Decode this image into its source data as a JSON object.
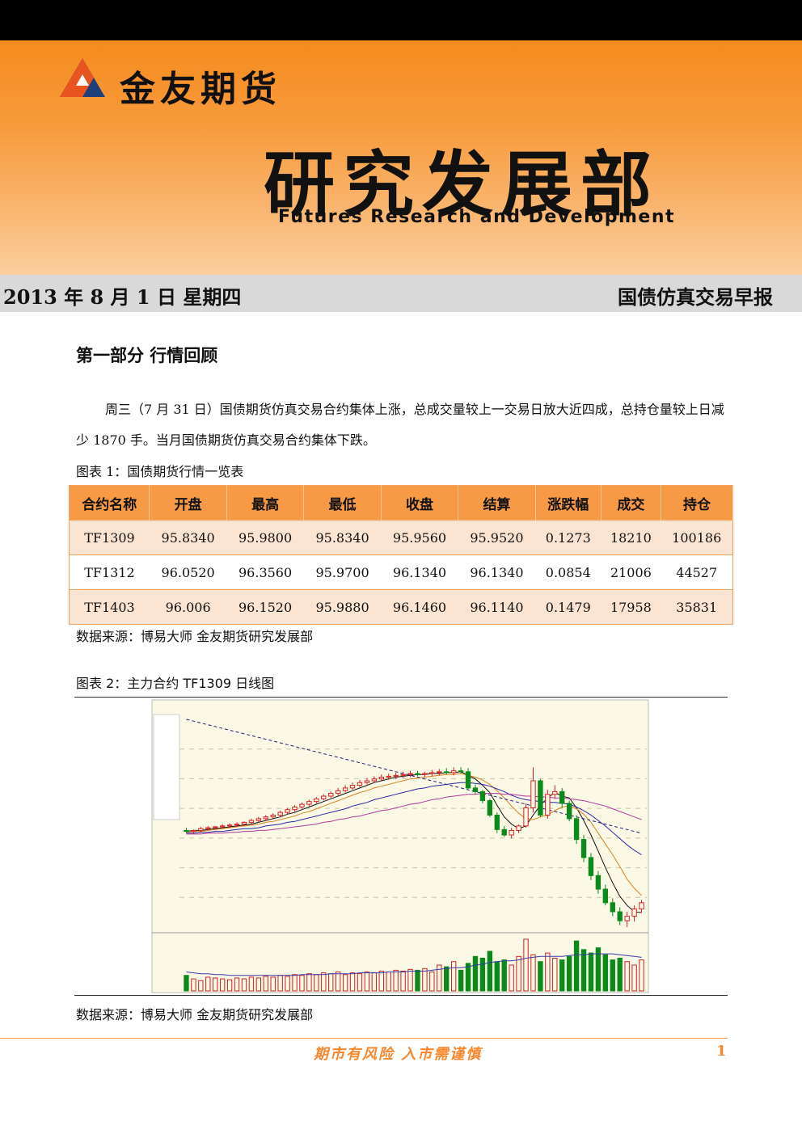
{
  "header": {
    "company": "金友期货",
    "department": "研究发展部",
    "department_en": "Futures Research and Development",
    "date": "2013 年 8 月 1 日 星期四",
    "report_title": "国债仿真交易早报"
  },
  "section": {
    "title": "第一部分 行情回顾",
    "paragraph": "周三（7 月 31 日）国债期货仿真交易合约集体上涨，总成交量较上一交易日放大近四成，总持仓量较上日减少 1870 手。当月国债期货仿真交易合约集体下跌。"
  },
  "table": {
    "caption": "图表 1：国债期货行情一览表",
    "headers": [
      "合约名称",
      "开盘",
      "最高",
      "最低",
      "收盘",
      "结算",
      "涨跌幅",
      "成交",
      "持仓"
    ],
    "rows": [
      [
        "TF1309",
        "95.8340",
        "95.9800",
        "95.8340",
        "95.9560",
        "95.9520",
        "0.1273",
        "18210",
        "100186"
      ],
      [
        "TF1312",
        "96.0520",
        "96.3560",
        "95.9700",
        "96.1340",
        "96.1340",
        "0.0854",
        "21006",
        "44527"
      ],
      [
        "TF1403",
        "96.006",
        "96.1520",
        "95.9880",
        "96.1460",
        "96.1140",
        "0.1479",
        "17958",
        "35831"
      ]
    ],
    "source": "数据来源：博易大师 金友期货研究发展部"
  },
  "chart_section": {
    "caption": "图表 2：主力合约 TF1309 日线图",
    "source": "数据来源：博易大师 金友期货研究发展部"
  },
  "chart_data": {
    "type": "candlestick",
    "title": "",
    "candles": [
      [
        94.75,
        94.78,
        94.72,
        94.74
      ],
      [
        94.74,
        94.76,
        94.71,
        94.75
      ],
      [
        94.75,
        94.79,
        94.73,
        94.77
      ],
      [
        94.77,
        94.8,
        94.75,
        94.78
      ],
      [
        94.78,
        94.8,
        94.76,
        94.79
      ],
      [
        94.79,
        94.82,
        94.77,
        94.8
      ],
      [
        94.8,
        94.83,
        94.78,
        94.81
      ],
      [
        94.81,
        94.84,
        94.79,
        94.82
      ],
      [
        94.82,
        94.85,
        94.8,
        94.84
      ],
      [
        94.84,
        94.88,
        94.82,
        94.86
      ],
      [
        94.86,
        94.9,
        94.84,
        94.88
      ],
      [
        94.88,
        94.92,
        94.86,
        94.9
      ],
      [
        94.9,
        94.94,
        94.88,
        94.92
      ],
      [
        94.92,
        94.97,
        94.9,
        94.95
      ],
      [
        94.95,
        95.0,
        94.93,
        94.98
      ],
      [
        94.98,
        95.03,
        94.96,
        95.01
      ],
      [
        95.01,
        95.06,
        94.99,
        95.04
      ],
      [
        95.04,
        95.09,
        95.02,
        95.07
      ],
      [
        95.07,
        95.12,
        95.05,
        95.1
      ],
      [
        95.1,
        95.15,
        95.08,
        95.13
      ],
      [
        95.13,
        95.18,
        95.11,
        95.16
      ],
      [
        95.16,
        95.22,
        95.14,
        95.19
      ],
      [
        95.19,
        95.25,
        95.17,
        95.22
      ],
      [
        95.22,
        95.28,
        95.2,
        95.25
      ],
      [
        95.25,
        95.31,
        95.23,
        95.28
      ],
      [
        95.28,
        95.33,
        95.26,
        95.3
      ],
      [
        95.3,
        95.35,
        95.28,
        95.32
      ],
      [
        95.32,
        95.37,
        95.3,
        95.34
      ],
      [
        95.34,
        95.38,
        95.31,
        95.35
      ],
      [
        95.35,
        95.39,
        95.32,
        95.36
      ],
      [
        95.36,
        95.4,
        95.33,
        95.37
      ],
      [
        95.37,
        95.41,
        95.34,
        95.38
      ],
      [
        95.38,
        95.41,
        95.35,
        95.37
      ],
      [
        95.37,
        95.4,
        95.34,
        95.38
      ],
      [
        95.38,
        95.42,
        95.35,
        95.39
      ],
      [
        95.39,
        95.43,
        95.36,
        95.4
      ],
      [
        95.4,
        95.44,
        95.37,
        95.39
      ],
      [
        95.39,
        95.45,
        95.36,
        95.41
      ],
      [
        95.41,
        95.45,
        95.38,
        95.4
      ],
      [
        95.4,
        95.44,
        95.2,
        95.22
      ],
      [
        95.22,
        95.26,
        95.15,
        95.18
      ],
      [
        95.18,
        95.2,
        95.05,
        95.08
      ],
      [
        95.08,
        95.1,
        94.9,
        94.92
      ],
      [
        94.92,
        94.95,
        94.72,
        94.76
      ],
      [
        94.76,
        94.8,
        94.68,
        94.7
      ],
      [
        94.7,
        94.78,
        94.66,
        94.75
      ],
      [
        94.75,
        94.82,
        94.72,
        94.8
      ],
      [
        94.8,
        95.05,
        94.78,
        95.0
      ],
      [
        95.0,
        95.45,
        94.95,
        95.3
      ],
      [
        95.3,
        95.32,
        94.9,
        94.92
      ],
      [
        94.92,
        95.2,
        94.88,
        95.15
      ],
      [
        95.15,
        95.25,
        95.1,
        95.18
      ],
      [
        95.18,
        95.22,
        95.0,
        95.05
      ],
      [
        95.05,
        95.08,
        94.85,
        94.88
      ],
      [
        94.88,
        94.92,
        94.6,
        94.65
      ],
      [
        94.65,
        94.7,
        94.4,
        94.45
      ],
      [
        94.45,
        94.5,
        94.2,
        94.25
      ],
      [
        94.25,
        94.3,
        94.05,
        94.1
      ],
      [
        94.1,
        94.15,
        93.92,
        93.95
      ],
      [
        93.95,
        94.0,
        93.8,
        93.85
      ],
      [
        93.85,
        93.9,
        93.7,
        93.75
      ],
      [
        93.75,
        93.85,
        93.68,
        93.8
      ],
      [
        93.8,
        93.92,
        93.74,
        93.88
      ],
      [
        93.88,
        93.98,
        93.84,
        93.95
      ]
    ],
    "ma": [
      {
        "color": "#111111",
        "values": [
          94.74,
          94.75,
          94.75,
          94.76,
          94.77,
          94.78,
          94.79,
          94.8,
          94.81,
          94.82,
          94.84,
          94.86,
          94.88,
          94.9,
          94.93,
          94.95,
          94.98,
          95.01,
          95.04,
          95.07,
          95.1,
          95.13,
          95.16,
          95.19,
          95.22,
          95.25,
          95.28,
          95.3,
          95.32,
          95.34,
          95.35,
          95.36,
          95.37,
          95.37,
          95.38,
          95.38,
          95.39,
          95.39,
          95.4,
          95.36,
          95.32,
          95.25,
          95.17,
          95.03,
          94.9,
          94.82,
          94.77,
          94.8,
          94.92,
          95.03,
          95.11,
          95.17,
          95.13,
          95.11,
          95.0,
          94.86,
          94.7,
          94.52,
          94.34,
          94.17,
          94.02,
          93.92,
          93.85,
          93.84
        ]
      },
      {
        "color": "#d98324",
        "values": [
          94.73,
          94.74,
          94.74,
          94.75,
          94.76,
          94.77,
          94.78,
          94.79,
          94.8,
          94.81,
          94.82,
          94.84,
          94.85,
          94.87,
          94.89,
          94.91,
          94.94,
          94.96,
          94.99,
          95.02,
          95.05,
          95.08,
          95.11,
          95.14,
          95.17,
          95.19,
          95.22,
          95.24,
          95.26,
          95.28,
          95.3,
          95.32,
          95.33,
          95.34,
          95.35,
          95.36,
          95.37,
          95.37,
          95.38,
          95.36,
          95.34,
          95.31,
          95.26,
          95.19,
          95.11,
          95.02,
          94.94,
          94.88,
          94.87,
          94.9,
          94.92,
          94.97,
          95.01,
          95.02,
          94.99,
          94.93,
          94.84,
          94.72,
          94.6,
          94.48,
          94.35,
          94.21,
          94.11,
          94.03
        ]
      },
      {
        "color": "#2a2aa0",
        "values": [
          94.72,
          94.72,
          94.73,
          94.73,
          94.74,
          94.74,
          94.75,
          94.76,
          94.77,
          94.77,
          94.78,
          94.8,
          94.81,
          94.82,
          94.84,
          94.85,
          94.87,
          94.89,
          94.91,
          94.93,
          94.95,
          94.97,
          94.99,
          95.02,
          95.04,
          95.06,
          95.09,
          95.11,
          95.13,
          95.15,
          95.17,
          95.19,
          95.21,
          95.22,
          95.24,
          95.25,
          95.26,
          95.27,
          95.28,
          95.28,
          95.27,
          95.26,
          95.24,
          95.21,
          95.18,
          95.14,
          95.11,
          95.09,
          95.08,
          95.07,
          95.06,
          95.06,
          95.05,
          95.04,
          95.01,
          94.97,
          94.92,
          94.86,
          94.8,
          94.73,
          94.66,
          94.59,
          94.53,
          94.48
        ]
      },
      {
        "color": "#b03aa0",
        "values": [
          94.71,
          94.71,
          94.71,
          94.72,
          94.72,
          94.72,
          94.73,
          94.73,
          94.74,
          94.74,
          94.75,
          94.75,
          94.76,
          94.77,
          94.78,
          94.79,
          94.8,
          94.81,
          94.82,
          94.84,
          94.85,
          94.87,
          94.88,
          94.9,
          94.91,
          94.93,
          94.95,
          94.97,
          94.98,
          95.0,
          95.02,
          95.04,
          95.05,
          95.07,
          95.09,
          95.1,
          95.12,
          95.13,
          95.14,
          95.15,
          95.15,
          95.16,
          95.16,
          95.16,
          95.15,
          95.15,
          95.14,
          95.13,
          95.13,
          95.12,
          95.12,
          95.11,
          95.11,
          95.1,
          95.09,
          95.08,
          95.06,
          95.04,
          95.02,
          94.99,
          94.96,
          94.93,
          94.9,
          94.87
        ]
      },
      {
        "color": "#1f1f7a",
        "dash": true,
        "values": [
          95.98,
          95.96,
          95.94,
          95.92,
          95.9,
          95.88,
          95.86,
          95.84,
          95.82,
          95.8,
          95.78,
          95.76,
          95.74,
          95.72,
          95.7,
          95.68,
          95.66,
          95.64,
          95.62,
          95.6,
          95.58,
          95.56,
          95.54,
          95.52,
          95.5,
          95.48,
          95.46,
          95.44,
          95.42,
          95.4,
          95.38,
          95.36,
          95.34,
          95.32,
          95.3,
          95.28,
          95.26,
          95.24,
          95.22,
          95.2,
          95.18,
          95.16,
          95.14,
          95.12,
          95.1,
          95.08,
          95.06,
          95.04,
          95.02,
          95.0,
          94.98,
          94.96,
          94.94,
          94.92,
          94.9,
          94.88,
          94.86,
          94.84,
          94.82,
          94.8,
          94.78,
          94.76,
          94.74,
          94.72
        ]
      }
    ],
    "volume": [
      18,
      14,
      12,
      16,
      15,
      14,
      13,
      15,
      14,
      16,
      15,
      17,
      16,
      18,
      17,
      19,
      18,
      20,
      19,
      21,
      20,
      22,
      19,
      21,
      20,
      22,
      21,
      23,
      22,
      24,
      23,
      25,
      24,
      26,
      22,
      30,
      28,
      34,
      24,
      32,
      40,
      38,
      46,
      34,
      36,
      30,
      40,
      60,
      42,
      34,
      44,
      38,
      36,
      40,
      58,
      48,
      44,
      50,
      42,
      36,
      38,
      34,
      30,
      36
    ],
    "volume_ma": [
      22,
      21,
      20,
      20,
      19,
      19,
      18,
      18,
      18,
      18,
      18,
      18,
      18,
      18,
      18,
      18,
      19,
      19,
      19,
      19,
      20,
      20,
      20,
      20,
      21,
      21,
      21,
      21,
      22,
      22,
      22,
      23,
      23,
      23,
      24,
      25,
      26,
      27,
      27,
      28,
      30,
      31,
      33,
      34,
      35,
      35,
      36,
      38,
      39,
      40,
      40,
      40,
      40,
      41,
      42,
      42,
      43,
      43,
      43,
      43,
      42,
      41,
      40,
      39
    ]
  }
}
